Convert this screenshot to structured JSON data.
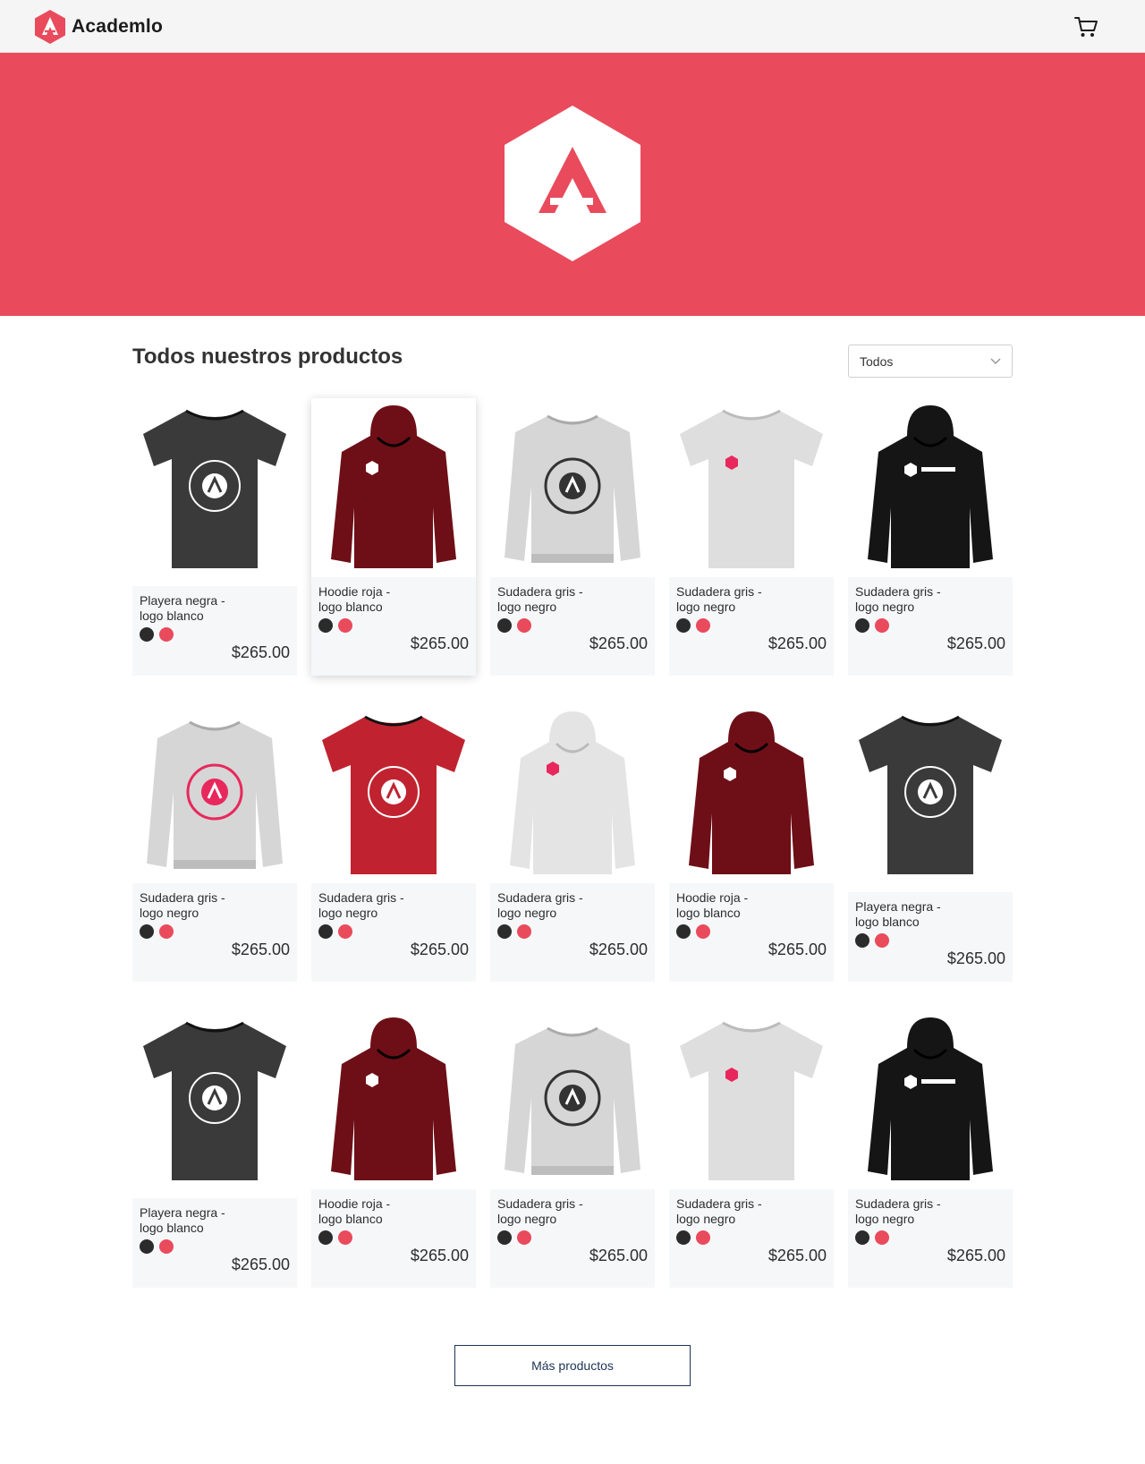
{
  "header": {
    "brand": "Academlo"
  },
  "section": {
    "title": "Todos nuestros productos",
    "filter_value": "Todos"
  },
  "colors": {
    "accent": "#e94b5c",
    "swatch_dark": "#2b2b2b",
    "swatch_red": "#e94b5c"
  },
  "products": [
    {
      "name": "Playera negra - logo blanco",
      "price": "$265.00",
      "garment": "tshirt",
      "fabric": "#3a3a3a",
      "print": "circle-white"
    },
    {
      "name": "Hoodie roja - logo blanco",
      "price": "$265.00",
      "garment": "hoodie",
      "fabric": "#6e0f17",
      "print": "small-white"
    },
    {
      "name": "Sudadera gris - logo negro",
      "price": "$265.00",
      "garment": "sweater",
      "fabric": "#d6d6d6",
      "print": "circle-dark"
    },
    {
      "name": "Sudadera gris - logo negro",
      "price": "$265.00",
      "garment": "tshirt",
      "fabric": "#dedede",
      "print": "small-red"
    },
    {
      "name": "Sudadera gris - logo negro",
      "price": "$265.00",
      "garment": "hoodie",
      "fabric": "#151515",
      "print": "wordmark"
    },
    {
      "name": "Sudadera gris - logo negro",
      "price": "$265.00",
      "garment": "sweater",
      "fabric": "#d6d6d6",
      "print": "circle-red"
    },
    {
      "name": "Sudadera gris - logo negro",
      "price": "$265.00",
      "garment": "tshirt",
      "fabric": "#c0232f",
      "print": "circle-white"
    },
    {
      "name": "Sudadera gris - logo negro",
      "price": "$265.00",
      "garment": "hoodie",
      "fabric": "#e4e4e4",
      "print": "small-red"
    },
    {
      "name": "Hoodie roja - logo blanco",
      "price": "$265.00",
      "garment": "hoodie",
      "fabric": "#6e0f17",
      "print": "small-white"
    },
    {
      "name": "Playera negra - logo blanco",
      "price": "$265.00",
      "garment": "tshirt",
      "fabric": "#3a3a3a",
      "print": "circle-white"
    },
    {
      "name": "Playera negra - logo blanco",
      "price": "$265.00",
      "garment": "tshirt",
      "fabric": "#3a3a3a",
      "print": "circle-white"
    },
    {
      "name": "Hoodie roja - logo blanco",
      "price": "$265.00",
      "garment": "hoodie",
      "fabric": "#6e0f17",
      "print": "small-white"
    },
    {
      "name": "Sudadera gris - logo negro",
      "price": "$265.00",
      "garment": "sweater",
      "fabric": "#d6d6d6",
      "print": "circle-dark"
    },
    {
      "name": "Sudadera gris - logo negro",
      "price": "$265.00",
      "garment": "tshirt",
      "fabric": "#dedede",
      "print": "small-red"
    },
    {
      "name": "Sudadera gris - logo negro",
      "price": "$265.00",
      "garment": "hoodie",
      "fabric": "#151515",
      "print": "wordmark"
    }
  ],
  "more_button": "Más productos"
}
